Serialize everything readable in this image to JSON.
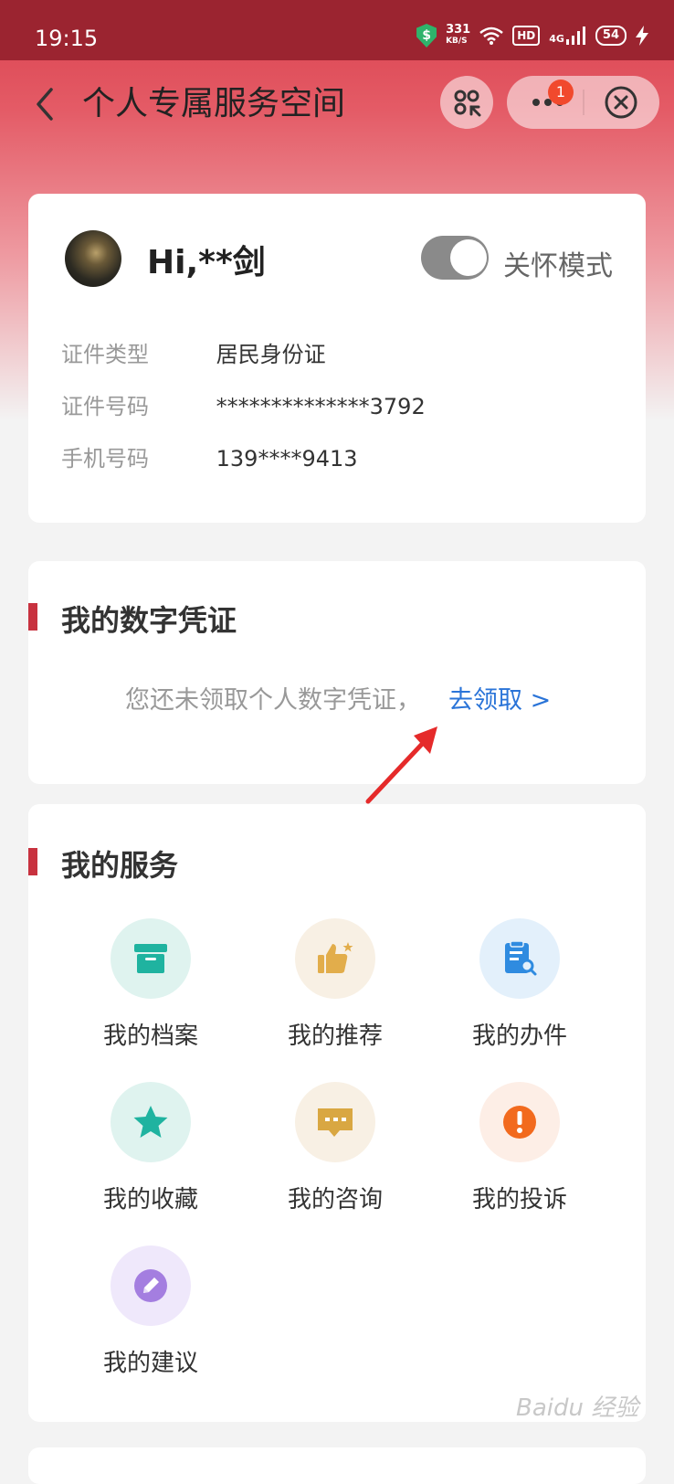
{
  "status_bar": {
    "time": "19:15",
    "speed_value": "331",
    "speed_unit": "KB/S",
    "hd": "HD",
    "network": "4G",
    "battery": "54",
    "shield_symbol": "$"
  },
  "nav": {
    "title": "个人专属服务空间",
    "badge_count": "1"
  },
  "profile": {
    "greeting": "Hi,**剑",
    "care_mode_label": "关怀模式",
    "care_mode_on": false,
    "rows": [
      {
        "label": "证件类型",
        "value": "居民身份证"
      },
      {
        "label": "证件号码",
        "value": "**************3792"
      },
      {
        "label": "手机号码",
        "value": "139****9413"
      }
    ]
  },
  "digital_cert": {
    "title": "我的数字凭证",
    "message": "您还未领取个人数字凭证，",
    "link": "去领取 >"
  },
  "services": {
    "title": "我的服务",
    "items": [
      {
        "label": "我的档案",
        "icon": "archive-box-icon",
        "bg": "#dff3ef",
        "fg": "#1fb3a0"
      },
      {
        "label": "我的推荐",
        "icon": "thumbs-up-icon",
        "bg": "#f8f0e4",
        "fg": "#e2ad4b"
      },
      {
        "label": "我的办件",
        "icon": "document-search-icon",
        "bg": "#e3f0fb",
        "fg": "#2f8be0"
      },
      {
        "label": "我的收藏",
        "icon": "star-icon",
        "bg": "#dff3ef",
        "fg": "#1fb3a0"
      },
      {
        "label": "我的咨询",
        "icon": "chat-bubble-icon",
        "bg": "#f8f0e4",
        "fg": "#d9a742"
      },
      {
        "label": "我的投诉",
        "icon": "warning-icon",
        "bg": "#fdeee6",
        "fg": "#f26a1e"
      },
      {
        "label": "我的建议",
        "icon": "pencil-icon",
        "bg": "#efe8fb",
        "fg": "#a47ee0"
      }
    ]
  },
  "watermark": "Baidu 经验",
  "colors": {
    "accent": "#c8323f",
    "link": "#2a74d8"
  }
}
